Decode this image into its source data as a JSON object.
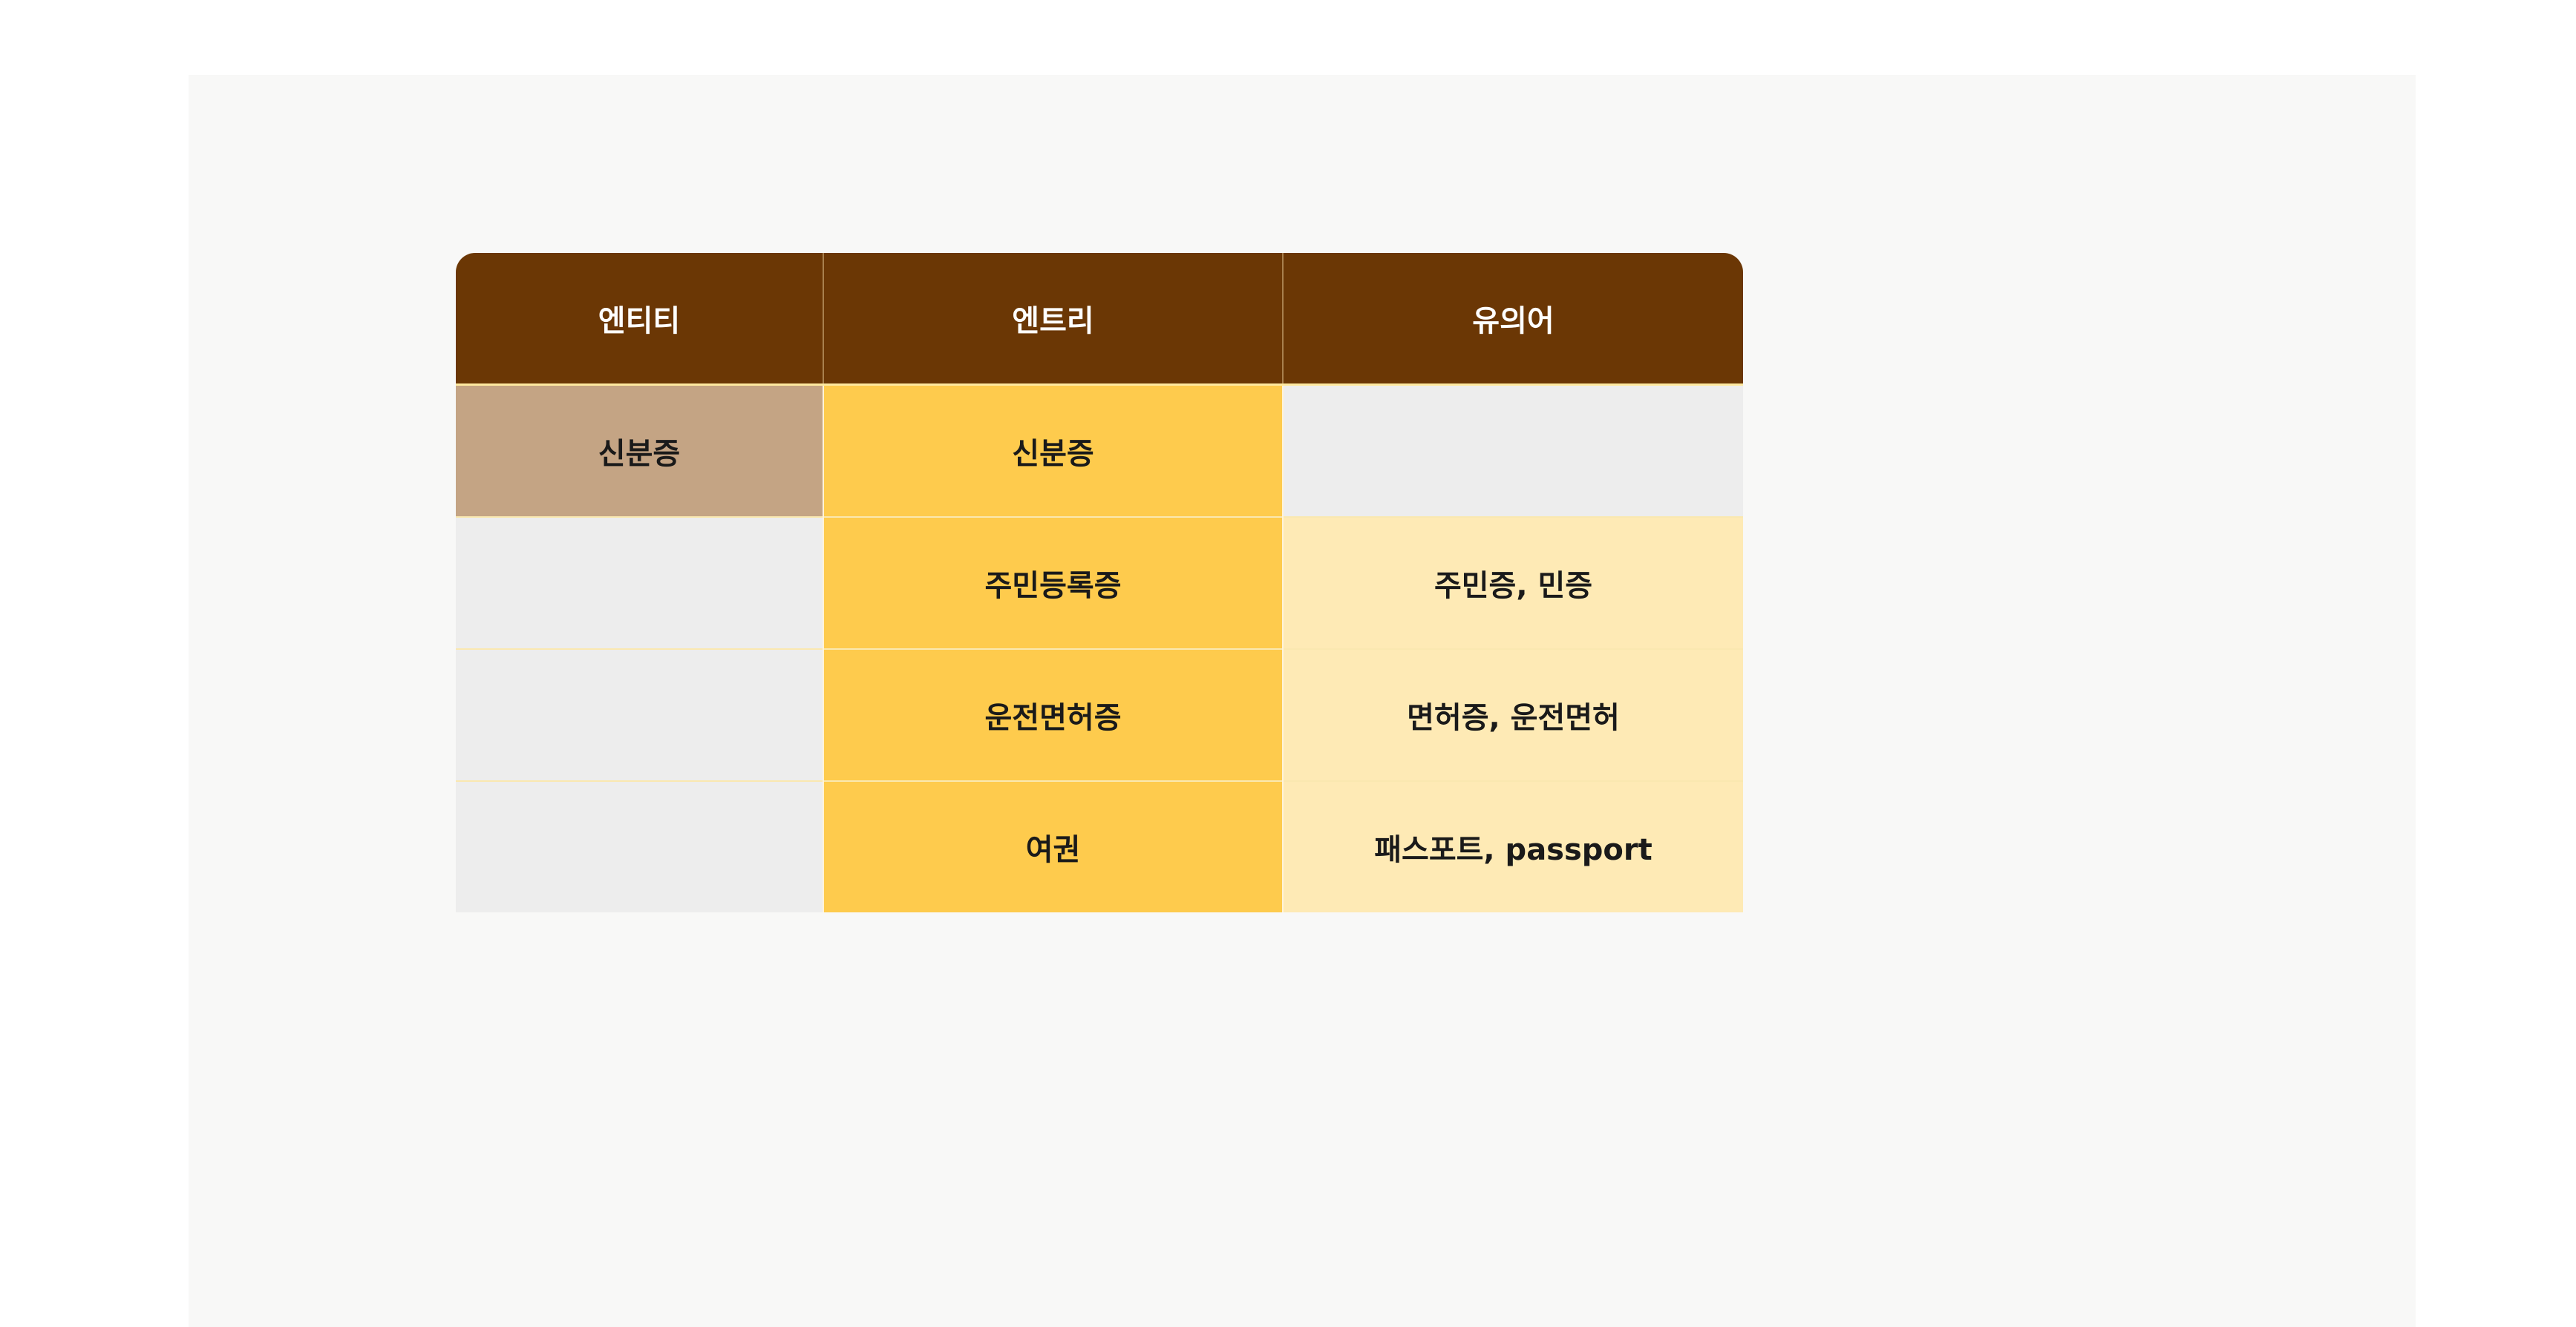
{
  "table": {
    "headers": [
      "엔티티",
      "엔트리",
      "유의어"
    ],
    "rows": [
      {
        "entity": "신분증",
        "entry": "신분증",
        "synonyms": ""
      },
      {
        "entity": "",
        "entry": "주민등록증",
        "synonyms": "주민증, 민증"
      },
      {
        "entity": "",
        "entry": "운전면허증",
        "synonyms": "면허증, 운전면허"
      },
      {
        "entity": "",
        "entry": "여권",
        "synonyms": "패스포트, passport"
      }
    ]
  },
  "colors": {
    "header_background": "#6b3705",
    "entity_highlight": "#c4a484",
    "entry_column": "#fecb4d",
    "synonym_column": "#feeab5",
    "empty_cell": "#ededed"
  }
}
